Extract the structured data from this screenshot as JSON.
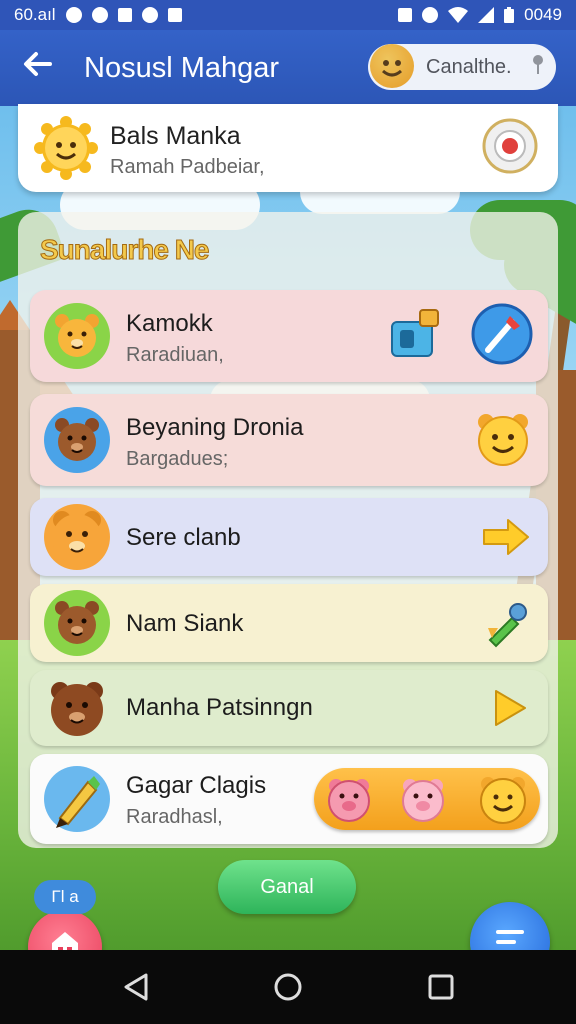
{
  "status_bar": {
    "left_text": "60.aıl",
    "right_text": "0049",
    "icons": [
      "record-icon",
      "settings-icon",
      "image-icon",
      "navigation-icon",
      "home-icon",
      "nfc-icon",
      "alarm-icon",
      "wifi-icon",
      "signal-icon",
      "battery-icon"
    ]
  },
  "app_bar": {
    "title": "Nosusl Mahgar",
    "account_label": "Canalthe."
  },
  "top_card": {
    "name": "Bals Manka",
    "subtitle": "Ramah Padbeiar,"
  },
  "panel": {
    "title": "Sunalurhe Ne",
    "rows": [
      {
        "name": "Kamokk",
        "subtitle": "Raradiuan,",
        "color": "#f6d9da"
      },
      {
        "name": "Beyaning Dronia",
        "subtitle": "Bargadues;",
        "color": "#f6dcd9"
      },
      {
        "name": "Sere clanb",
        "subtitle": "",
        "color": "#dee1f6"
      },
      {
        "name": "Nam Siank",
        "subtitle": "",
        "color": "#f7f1d1"
      },
      {
        "name": "Manha Patsinngn",
        "subtitle": "",
        "color": "#dfeccd"
      },
      {
        "name": "Gagar Clagis",
        "subtitle": "Raradhasl,",
        "color": "#fbfbfb"
      }
    ]
  },
  "bottom": {
    "center_button": "Ganal",
    "chip_label": "Γl a"
  },
  "colors": {
    "app_bar": "#2f55b8",
    "accent_orange": "#f5a623",
    "fab_pink": "#e8405c",
    "fab_blue": "#2366d8",
    "green_button": "#2eb45a"
  }
}
